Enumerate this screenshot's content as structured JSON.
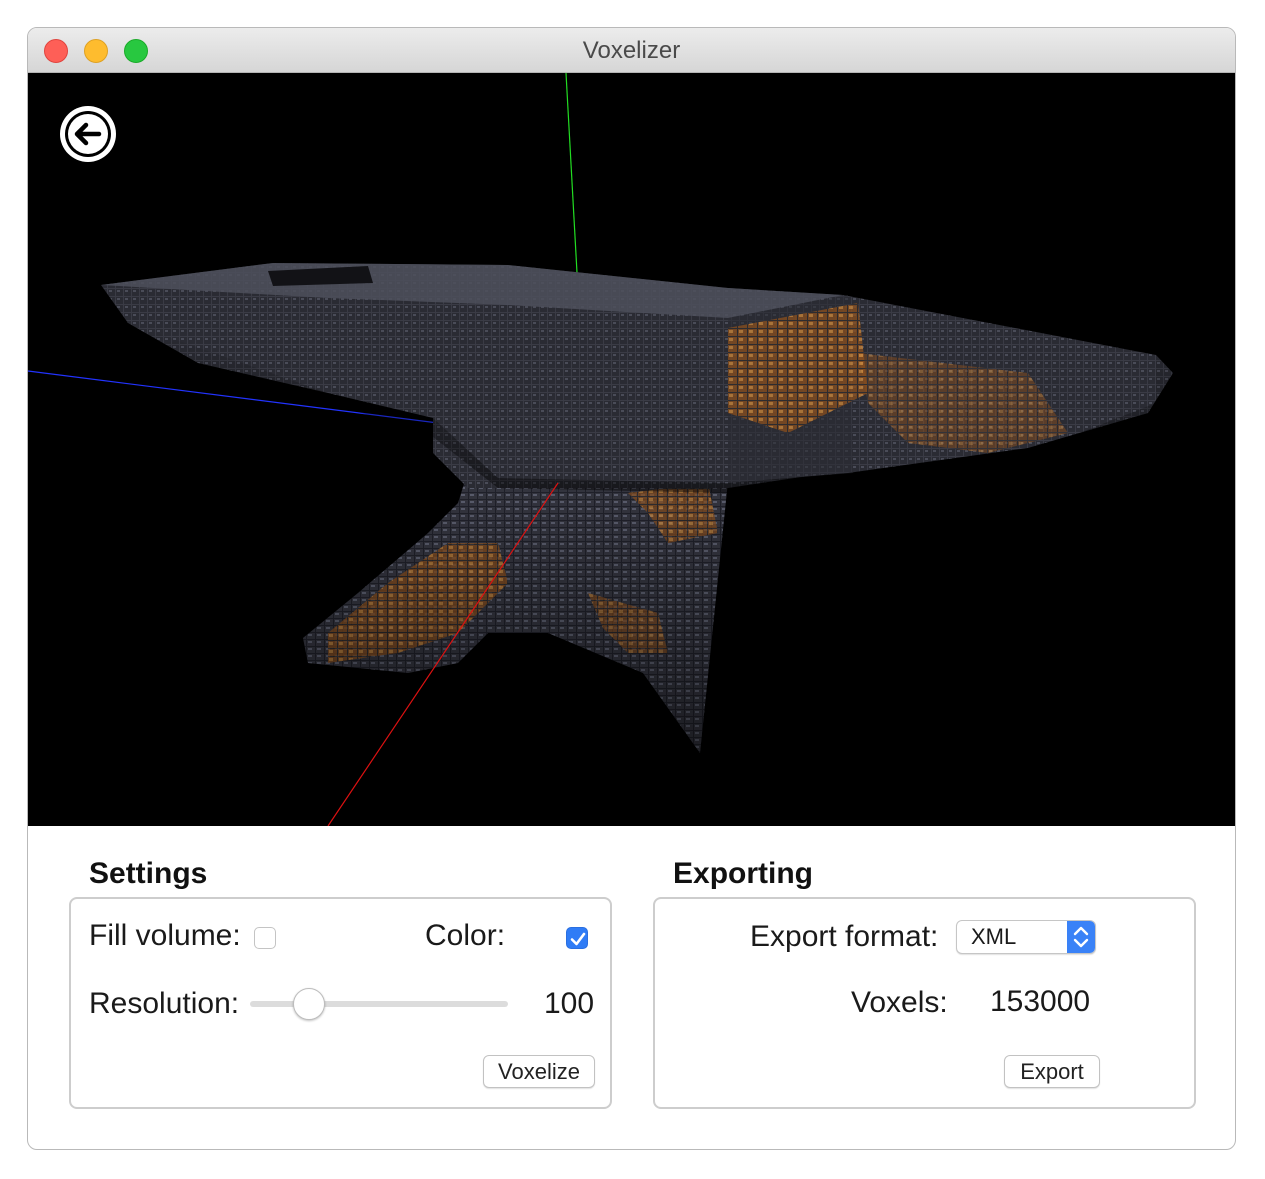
{
  "window": {
    "title": "Voxelizer"
  },
  "viewport": {
    "back_icon": "arrow-left-circle-icon",
    "axis_colors": {
      "x": "#ff0000",
      "y": "#00ff00",
      "z": "#0000ff"
    }
  },
  "settings": {
    "title": "Settings",
    "fill_volume_label": "Fill volume:",
    "fill_volume_checked": false,
    "color_label": "Color:",
    "color_checked": true,
    "resolution_label": "Resolution:",
    "resolution_value": "100",
    "resolution_fraction": 0.23,
    "voxelize_label": "Voxelize"
  },
  "exporting": {
    "title": "Exporting",
    "format_label": "Export format:",
    "format_value": "XML",
    "voxels_label": "Voxels:",
    "voxels_value": "153000",
    "export_label": "Export"
  },
  "colors": {
    "accent": "#2f7cf6",
    "viewport_background": "#000000"
  }
}
